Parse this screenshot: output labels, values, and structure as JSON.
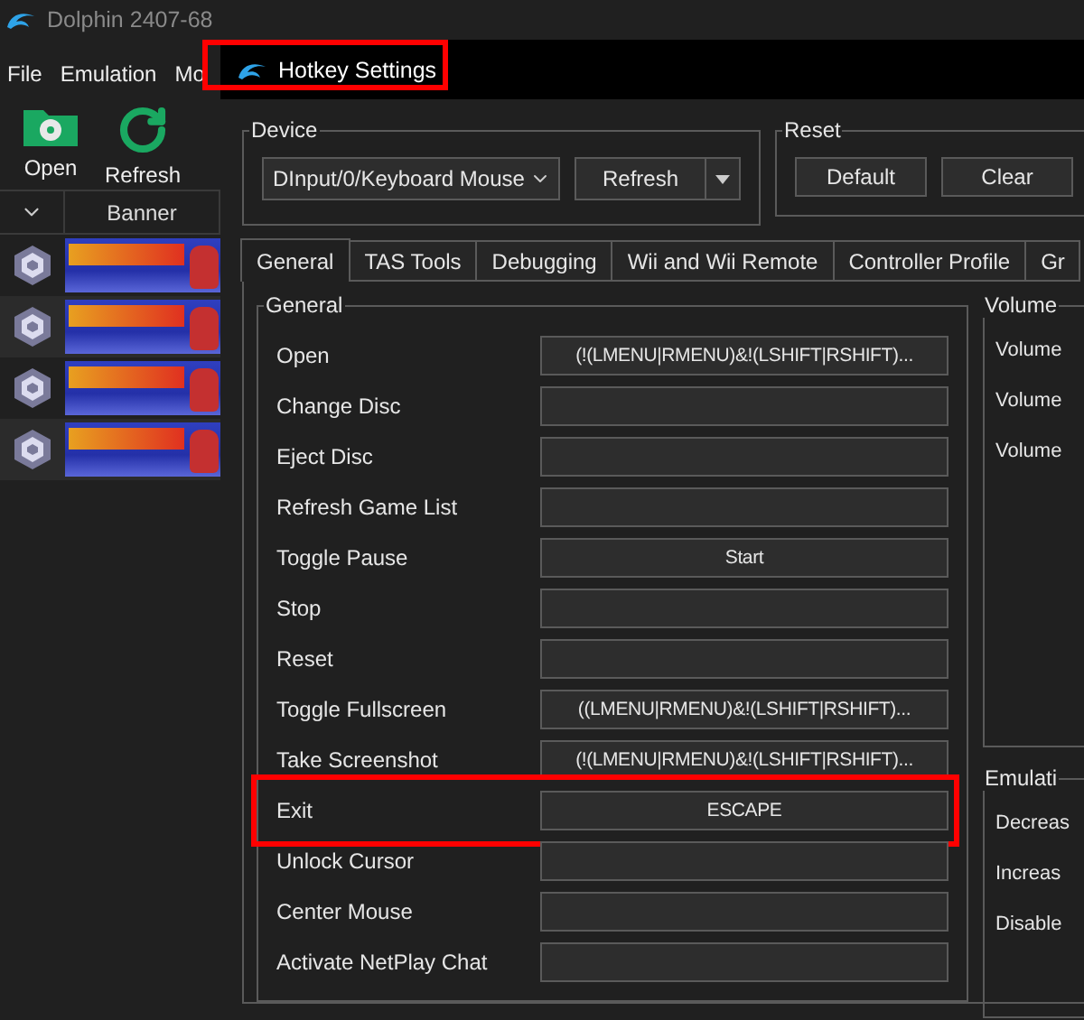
{
  "main_window": {
    "title": "Dolphin 2407-68",
    "menu": [
      "File",
      "Emulation",
      "Mo"
    ],
    "toolbar": [
      {
        "label": "Open",
        "kind": "open"
      },
      {
        "label": "Refresh",
        "kind": "refresh"
      }
    ],
    "game_list": {
      "columns": [
        "Banner"
      ],
      "games": [
        {
          "kind": "gamecube"
        },
        {
          "kind": "gamecube"
        },
        {
          "kind": "gamecube"
        },
        {
          "kind": "gamecube"
        }
      ]
    }
  },
  "dialog": {
    "title": "Hotkey Settings",
    "highlighted": true,
    "device": {
      "label": "Device",
      "value": "DInput/0/Keyboard Mouse",
      "refresh": "Refresh"
    },
    "reset": {
      "label": "Reset",
      "buttons": [
        "Default",
        "Clear"
      ]
    },
    "tabs": [
      {
        "label": "General",
        "selected": true
      },
      {
        "label": "TAS Tools",
        "selected": false
      },
      {
        "label": "Debugging",
        "selected": false
      },
      {
        "label": "Wii and Wii Remote",
        "selected": false
      },
      {
        "label": "Controller Profile",
        "selected": false
      },
      {
        "label": "Gr",
        "selected": false
      }
    ],
    "general": {
      "title": "General",
      "hotkeys": [
        {
          "label": "Open",
          "binding": "(!(LMENU|RMENU)&!(LSHIFT|RSHIFT)...",
          "highlighted": false
        },
        {
          "label": "Change Disc",
          "highlighted": false
        },
        {
          "label": "Eject Disc",
          "highlighted": false
        },
        {
          "label": "Refresh Game List",
          "highlighted": false
        },
        {
          "label": "Toggle Pause",
          "binding": "Start",
          "highlighted": false
        },
        {
          "label": "Stop",
          "highlighted": false
        },
        {
          "label": "Reset",
          "highlighted": false
        },
        {
          "label": "Toggle Fullscreen",
          "binding": "((LMENU|RMENU)&!(LSHIFT|RSHIFT)...",
          "highlighted": false
        },
        {
          "label": "Take Screenshot",
          "binding": "(!(LMENU|RMENU)&!(LSHIFT|RSHIFT)...",
          "highlighted": false
        },
        {
          "label": "Exit",
          "binding": "ESCAPE",
          "highlighted": true
        },
        {
          "label": "Unlock Cursor",
          "highlighted": false
        },
        {
          "label": "Center Mouse",
          "highlighted": false
        },
        {
          "label": "Activate NetPlay Chat",
          "highlighted": false
        }
      ]
    },
    "side_groups": [
      {
        "title": "Volume",
        "items": [
          "Volume",
          "Volume",
          "Volume"
        ]
      },
      {
        "title": "Emulati",
        "items": [
          "Decreas",
          "Increas",
          "Disable"
        ]
      }
    ]
  }
}
